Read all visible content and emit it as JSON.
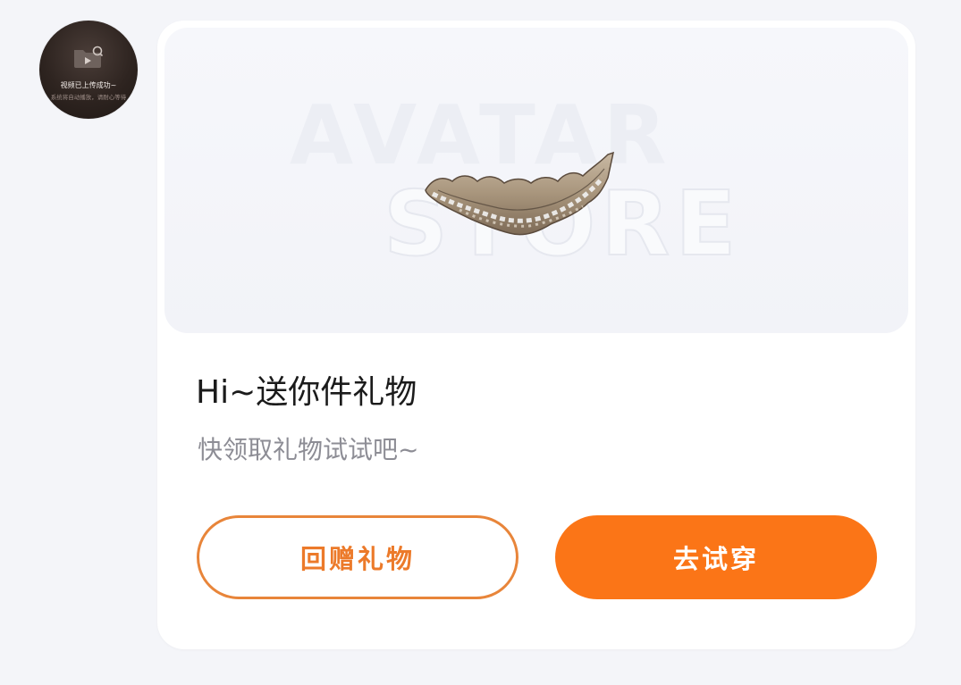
{
  "avatar": {
    "caption": "视频已上传成功~",
    "subcaption": "系统将自动播放，请耐心等待"
  },
  "card": {
    "watermark_line1": "AVATAR",
    "watermark_line2": "STORE",
    "title": "Hi~送你件礼物",
    "subtitle": "快领取礼物试试吧~",
    "buttons": {
      "return_gift": "回赠礼物",
      "try_on": "去试穿"
    }
  },
  "colors": {
    "accent": "#fb7517",
    "outline": "#e8853a",
    "background": "#f4f5f9",
    "card": "#ffffff",
    "hero": "#f4f5f9"
  }
}
